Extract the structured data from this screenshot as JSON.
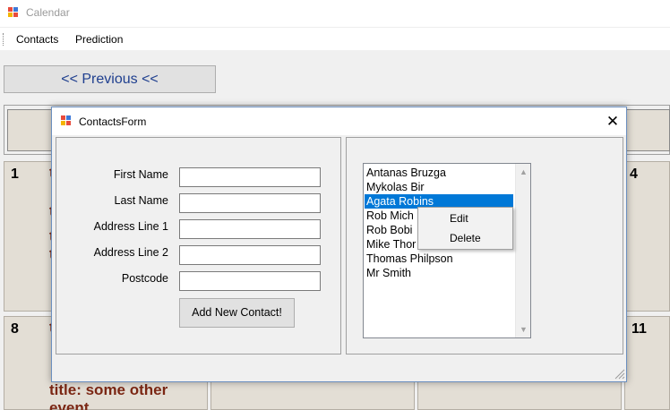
{
  "window": {
    "title": "Calendar"
  },
  "menu": {
    "items": [
      "Contacts",
      "Prediction"
    ]
  },
  "navigation": {
    "previous_label": "<< Previous <<"
  },
  "calendar": {
    "days": [
      "1",
      "4",
      "8",
      "11"
    ],
    "event_fragments": [
      "t",
      "t",
      "t",
      "t",
      "t"
    ],
    "event_text": "title: some other",
    "event_text_cut": "event"
  },
  "dialog": {
    "title": "ContactsForm",
    "close_glyph": "✕",
    "fields": [
      {
        "label": "First Name",
        "value": ""
      },
      {
        "label": "Last Name",
        "value": ""
      },
      {
        "label": "Address Line 1",
        "value": ""
      },
      {
        "label": "Address Line 2",
        "value": ""
      },
      {
        "label": "Postcode",
        "value": ""
      }
    ],
    "add_button": "Add New Contact!",
    "contacts": [
      "Antanas Bruzga",
      "Mykolas Bir",
      "Agata Robins",
      "Rob Mich",
      "Rob Bobi",
      "Mike Thor",
      "Thomas Philpson",
      "Mr Smith"
    ],
    "selected_contact": "Agata Robins",
    "context_menu": [
      "Edit",
      "Delete"
    ]
  },
  "colors": {
    "accent": "#0078d7",
    "event_text": "#7b2714",
    "cell_bg": "#e3ded5",
    "nav_text": "#1f3f8f"
  },
  "icons": [
    "app-icon",
    "close-icon",
    "resize-grip-icon",
    "scroll-up-icon",
    "scroll-down-icon"
  ]
}
